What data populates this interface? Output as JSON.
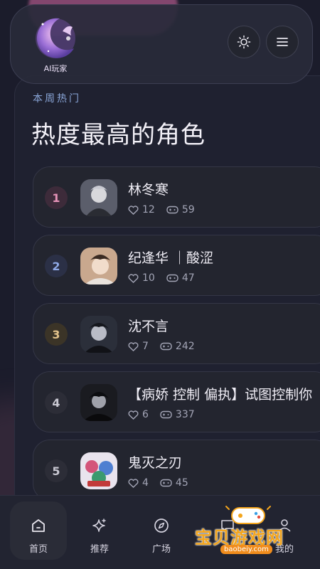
{
  "app": {
    "logo_name": "AI玩家"
  },
  "section": {
    "subtitle": "本周热门",
    "title": "热度最高的角色"
  },
  "characters": [
    {
      "rank": "1",
      "name": "林冬寒",
      "likes": "12",
      "plays": "59",
      "rank_color": "#e693b8",
      "rank_bg": "#3d2b3a"
    },
    {
      "rank": "2",
      "name": "纪逢华 ｜酸涩",
      "likes": "10",
      "plays": "47",
      "rank_color": "#8fa9e6",
      "rank_bg": "#2b3046"
    },
    {
      "rank": "3",
      "name": "沈不言",
      "likes": "7",
      "plays": "242",
      "rank_color": "#e2c28a",
      "rank_bg": "#3b3427"
    },
    {
      "rank": "4",
      "name": "【病娇 控制 偏执】试图控制你",
      "likes": "6",
      "plays": "337",
      "rank_color": "#c9c8d2",
      "rank_bg": "#2c2d37"
    },
    {
      "rank": "5",
      "name": "鬼灭之刃",
      "likes": "4",
      "plays": "45",
      "rank_color": "#c9c8d2",
      "rank_bg": "#2c2d37"
    }
  ],
  "nav": [
    {
      "label": "首页",
      "icon": "home-icon",
      "active": true
    },
    {
      "label": "推荐",
      "icon": "sparkle-icon",
      "active": false
    },
    {
      "label": "广场",
      "icon": "compass-icon",
      "active": false
    },
    {
      "label": "",
      "icon": "chat-icon",
      "active": false
    },
    {
      "label": "我的",
      "icon": "user-icon",
      "active": false
    }
  ],
  "watermark": {
    "text": "宝贝游戏网",
    "url": "baobeiy.com"
  },
  "colors": {
    "background": "#1b1c2b",
    "card": "#23252f",
    "accent": "#8aa6d8"
  }
}
